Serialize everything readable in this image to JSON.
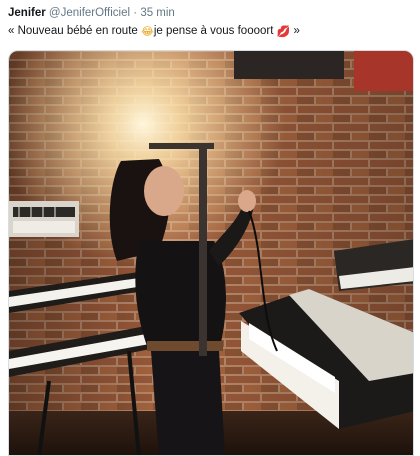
{
  "tweet": {
    "display_name": "Jenifer",
    "handle": "@JeniferOfficiel",
    "separator": "·",
    "time": "35 min",
    "text_before_emoji": "« Nouveau bébé en route ",
    "emoji_1": "😂",
    "text_middle": "je pense à vous foooort ",
    "emoji_2": "💋",
    "text_after_emoji": " »"
  },
  "media": {
    "kind": "photo",
    "subject": "woman posing among synthesizers in a brick-walled studio"
  },
  "colors": {
    "name": "#14171a",
    "meta": "#657786",
    "brick": "#9c5a3a",
    "mortar": "#c9a98c"
  }
}
